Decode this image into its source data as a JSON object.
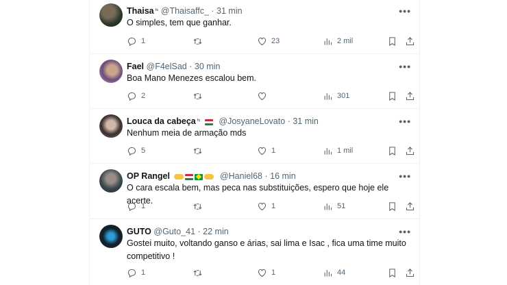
{
  "posts": [
    {
      "name": "Thaisa",
      "badge": "ᶠᶜ",
      "flags": [],
      "handle": "@Thaisaffc_",
      "time": "31 min",
      "text": "O simples, tem que ganhar.",
      "replies": "1",
      "retweets": "",
      "likes": "23",
      "views": "2 mil"
    },
    {
      "name": "Fael",
      "badge": "",
      "flags": [],
      "handle": "@F4elSad",
      "time": "30 min",
      "text": "Boa Mano Menezes escalou bem.",
      "replies": "2",
      "retweets": "",
      "likes": "",
      "views": "301"
    },
    {
      "name": "Louca da cabeça",
      "badge": "ᶠᶜ",
      "flags": [
        "hungary-flag"
      ],
      "handle": "@JosyaneLovato",
      "time": "31 min",
      "text": "Nenhum meia de armação mds",
      "replies": "5",
      "retweets": "",
      "likes": "1",
      "views": "1 mil"
    },
    {
      "name": "OP Rangel",
      "badge": "",
      "flags": [
        "hand-emoji",
        "hungary-flag",
        "brazil-flag",
        "hand-emoji"
      ],
      "handle": "@Haniel68",
      "time": "16 min",
      "text": "O cara escala bem, mas peca nas substituições, espero que hoje ele acerte.",
      "replies": "1",
      "retweets": "",
      "likes": "1",
      "views": "51"
    },
    {
      "name": "GUTO",
      "badge": "",
      "flags": [],
      "handle": "@Guto_41",
      "time": "22 min",
      "text": "Gostei muito, voltando ganso e árias, sai  lima e Isac , fica uma time muito competitivo !",
      "replies": "1",
      "retweets": "",
      "likes": "1",
      "views": "44"
    }
  ],
  "separator": "·",
  "more_label": "•••"
}
